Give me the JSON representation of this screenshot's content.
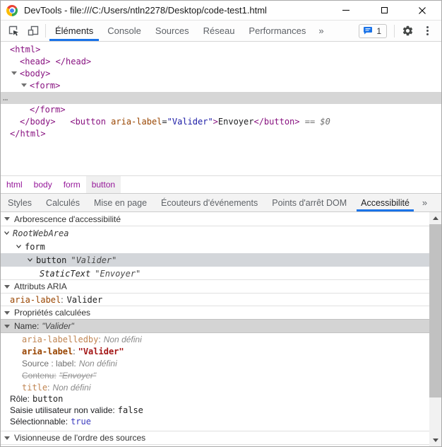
{
  "window": {
    "title": "DevTools - file:///C:/Users/ntln2278/Desktop/code-test1.html"
  },
  "toolbar": {
    "tabs": [
      "Éléments",
      "Console",
      "Sources",
      "Réseau",
      "Performances"
    ],
    "more_label": "»",
    "badge_count": "1"
  },
  "elements": {
    "html_open": "<html>",
    "head_line": "<head> </head>",
    "body_open": "<body>",
    "form_open": "<form>",
    "button": {
      "open": "<button ",
      "attr_name": "aria-label",
      "eq": "=",
      "attr_value": "\"Valider\"",
      "close_bracket": ">",
      "text": "Envoyer",
      "close": "</button>",
      "result_eq": " == ",
      "result_var": "$0",
      "overflow": "…"
    },
    "form_close": "</form>",
    "body_close": "</body>",
    "html_close": "</html>"
  },
  "breadcrumb": {
    "items": [
      "html",
      "body",
      "form",
      "button"
    ]
  },
  "sidebar_tabs": {
    "tabs": [
      "Styles",
      "Calculés",
      "Mise en page",
      "Écouteurs d'événements",
      "Points d'arrêt DOM",
      "Accessibilité"
    ],
    "more_label": "»"
  },
  "accessibility": {
    "tree_section_title": "Arborescence d'accessibilité",
    "tree": {
      "root": "RootWebArea",
      "form": "form",
      "button_role": "button",
      "button_name": "\"Valider\"",
      "static_text_role": "StaticText",
      "static_text_value": "\"Envoyer\""
    },
    "aria_section_title": "Attributs ARIA",
    "aria_attribute": {
      "name": "aria-label",
      "value": "Valider"
    },
    "computed_section_title": "Propriétés calculées",
    "name_section": {
      "label": "Name:",
      "value": "\"Valider\""
    },
    "name_details": {
      "labelledby_name": "aria-labelledby",
      "labelledby_value": "Non défini",
      "arialabel_name": "aria-label",
      "arialabel_value": "\"Valider\"",
      "source_label": "Source : label:",
      "source_value": "Non défini",
      "content_label": "Contenu:",
      "content_value": "\"Envoyer\"",
      "title_name": "title",
      "title_value": "Non défini"
    },
    "properties": {
      "role_label": "Rôle:",
      "role_value": "button",
      "invalid_label": "Saisie utilisateur non valide:",
      "invalid_value": "false",
      "focusable_label": "Sélectionnable:",
      "focusable_value": "true"
    },
    "source_order_section_title": "Visionneuse de l'ordre des sources"
  },
  "ui": {
    "colon": ":"
  },
  "colors": {
    "accent_blue": "#1a73e8",
    "tag_purple": "#881280",
    "attr_name_orange": "#994500",
    "attr_value_blue": "#1a1aa6",
    "string_red": "#a31515",
    "boolean_true_blue": "#3b3bbf",
    "selection_gray": "#d6d6d6",
    "badge_icon_blue": "#1a73e8"
  }
}
